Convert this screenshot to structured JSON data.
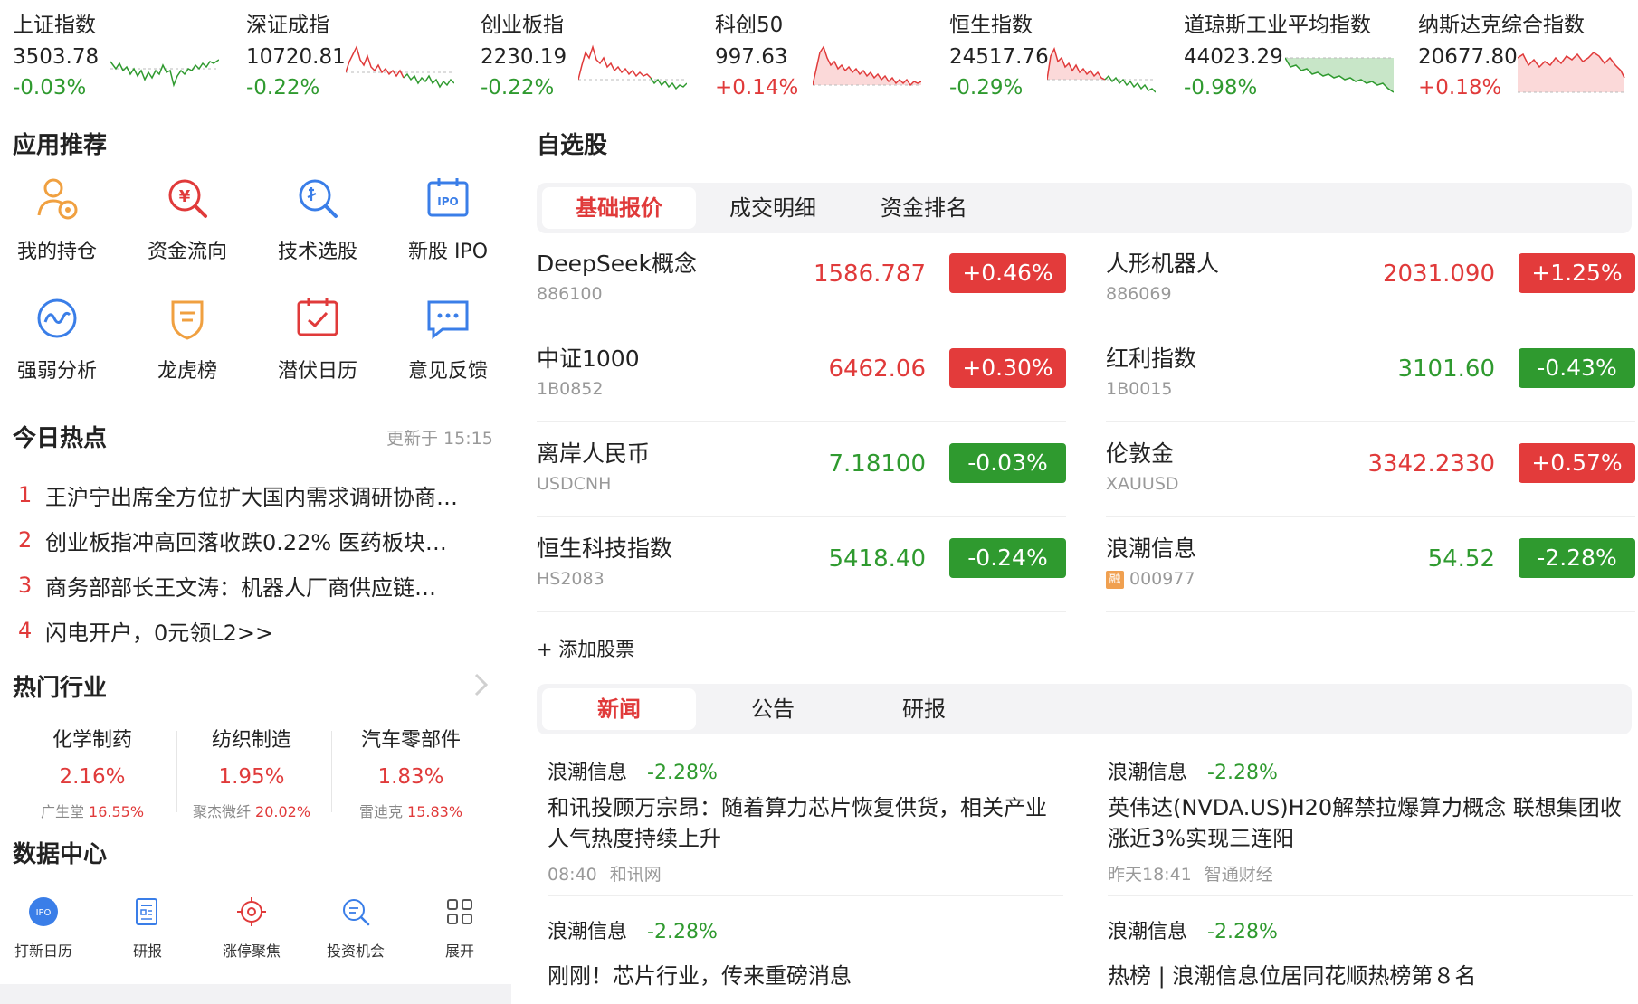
{
  "indices": [
    {
      "name": "上证指数",
      "price": "3503.78",
      "change": "-0.03%",
      "dir": "down"
    },
    {
      "name": "深证成指",
      "price": "10720.81",
      "change": "-0.22%",
      "dir": "down"
    },
    {
      "name": "创业板指",
      "price": "2230.19",
      "change": "-0.22%",
      "dir": "down"
    },
    {
      "name": "科创50",
      "price": "997.63",
      "change": "+0.14%",
      "dir": "up"
    },
    {
      "name": "恒生指数",
      "price": "24517.76",
      "change": "-0.29%",
      "dir": "down"
    },
    {
      "name": "道琼斯工业平均指数",
      "price": "44023.29",
      "change": "-0.98%",
      "dir": "down"
    },
    {
      "name": "纳斯达克综合指数",
      "price": "20677.80",
      "change": "+0.18%",
      "dir": "up"
    }
  ],
  "apps": {
    "title": "应用推荐",
    "items": [
      {
        "label": "我的持仓",
        "icon": "person-holding-icon"
      },
      {
        "label": "资金流向",
        "icon": "money-search-icon"
      },
      {
        "label": "技术选股",
        "icon": "stock-picker-icon"
      },
      {
        "label": "新股 IPO",
        "icon": "ipo-calendar-icon"
      },
      {
        "label": "强弱分析",
        "icon": "wave-analysis-icon"
      },
      {
        "label": "龙虎榜",
        "icon": "badge-shield-icon"
      },
      {
        "label": "潜伏日历",
        "icon": "calendar-check-icon"
      },
      {
        "label": "意见反馈",
        "icon": "chat-feedback-icon"
      }
    ]
  },
  "hot": {
    "title": "今日热点",
    "updated": "更新于 15:15",
    "items": [
      {
        "num": "1",
        "text": "王沪宁出席全方位扩大国内需求调研协商…"
      },
      {
        "num": "2",
        "text": "创业板指冲高回落收跌0.22% 医药板块…"
      },
      {
        "num": "3",
        "text": "商务部部长王文涛：机器人厂商供应链…"
      },
      {
        "num": "4",
        "text": "闪电开户，0元领L2>>"
      }
    ]
  },
  "industry": {
    "title": "热门行业",
    "items": [
      {
        "name": "化学制药",
        "change": "2.16%",
        "leader": "广生堂",
        "leader_change": "16.55%"
      },
      {
        "name": "纺织制造",
        "change": "1.95%",
        "leader": "聚杰微纤",
        "leader_change": "20.02%"
      },
      {
        "name": "汽车零部件",
        "change": "1.83%",
        "leader": "雷迪克",
        "leader_change": "15.83%"
      }
    ]
  },
  "data_center": {
    "title": "数据中心",
    "items": [
      {
        "label": "打新日历",
        "icon": "ipo-circle-icon",
        "icon_text": "IPO"
      },
      {
        "label": "研报",
        "icon": "report-icon"
      },
      {
        "label": "涨停聚焦",
        "icon": "target-icon"
      },
      {
        "label": "投资机会",
        "icon": "magnifier-icon"
      },
      {
        "label": "展开",
        "icon": "grid-icon"
      }
    ]
  },
  "watchlist": {
    "title": "自选股",
    "tabs": [
      "基础报价",
      "成交明细",
      "资金排名"
    ],
    "stocks": [
      {
        "name": "DeepSeek概念",
        "code": "886100",
        "price": "1586.787",
        "change": "+0.46%",
        "dir": "up"
      },
      {
        "name": "人形机器人",
        "code": "886069",
        "price": "2031.090",
        "change": "+1.25%",
        "dir": "up"
      },
      {
        "name": "中证1000",
        "code": "1B0852",
        "price": "6462.06",
        "change": "+0.30%",
        "dir": "up"
      },
      {
        "name": "红利指数",
        "code": "1B0015",
        "price": "3101.60",
        "change": "-0.43%",
        "dir": "down"
      },
      {
        "name": "离岸人民币",
        "code": "USDCNH",
        "price": "7.18100",
        "change": "-0.03%",
        "dir": "down"
      },
      {
        "name": "伦敦金",
        "code": "XAUUSD",
        "price": "3342.2330",
        "change": "+0.57%",
        "dir": "up"
      },
      {
        "name": "恒生科技指数",
        "code": "HS2083",
        "price": "5418.40",
        "change": "-0.24%",
        "dir": "down"
      },
      {
        "name": "浪潮信息",
        "code": "000977",
        "price": "54.52",
        "change": "-2.28%",
        "dir": "down",
        "badge": "融"
      }
    ],
    "add_label": "+ 添加股票"
  },
  "news": {
    "tabs": [
      "新闻",
      "公告",
      "研报"
    ],
    "items": [
      {
        "stock": "浪潮信息",
        "change": "-2.28%",
        "title": "和讯投顾万宗昂：随着算力芯片恢复供货，相关产业人气热度持续上升",
        "time": "08:40",
        "source": "和讯网"
      },
      {
        "stock": "浪潮信息",
        "change": "-2.28%",
        "title": "英伟达(NVDA.US)H20解禁拉爆算力概念 联想集团收涨近3%实现三连阳",
        "time": "昨天18:41",
        "source": "智通财经"
      },
      {
        "stock": "浪潮信息",
        "change": "-2.28%",
        "title": "刚刚！芯片行业，传来重磅消息",
        "time": "",
        "source": ""
      },
      {
        "stock": "浪潮信息",
        "change": "-2.28%",
        "title": "热榜 | 浪潮信息位居同花顺热榜第８名",
        "time": "",
        "source": ""
      }
    ]
  },
  "colors": {
    "up": "#e03a3a",
    "down": "#2f9a2f",
    "accent": "#e03a3a",
    "icon_blue": "#3a7ee8",
    "icon_orange": "#f0a040"
  }
}
